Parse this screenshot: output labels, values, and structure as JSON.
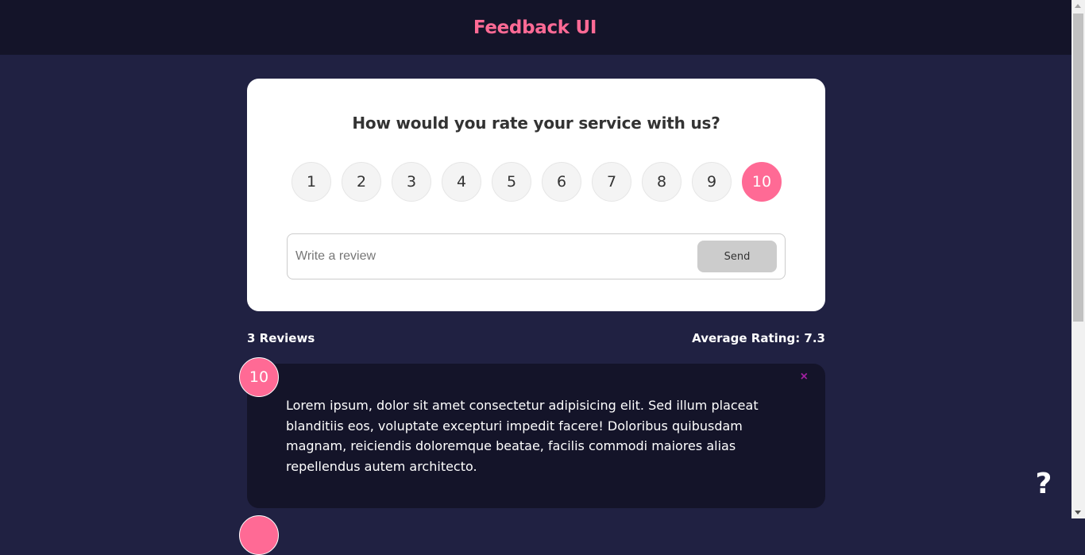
{
  "header": {
    "title": "Feedback UI"
  },
  "card": {
    "question": "How would you rate your service with us?",
    "ratings": [
      "1",
      "2",
      "3",
      "4",
      "5",
      "6",
      "7",
      "8",
      "9",
      "10"
    ],
    "selected_rating": "10",
    "input": {
      "placeholder": "Write a review",
      "value": ""
    },
    "send_label": "Send"
  },
  "stats": {
    "reviews_count": "3 Reviews",
    "average_rating": "Average Rating: 7.3"
  },
  "reviews": [
    {
      "rating": "10",
      "close_icon": "×",
      "text": "Lorem ipsum, dolor sit amet consectetur adipisicing elit. Sed illum placeat blanditiis eos, voluptate excepturi impedit facere! Doloribus quibusdam magnam, reiciendis doloremque beatae, facilis commodi maiores alias repellendus autem architecto."
    }
  ],
  "help": {
    "label": "?"
  },
  "colors": {
    "accent": "#ff6a95",
    "background": "#202142",
    "header": "#141429",
    "card": "#ffffff"
  }
}
